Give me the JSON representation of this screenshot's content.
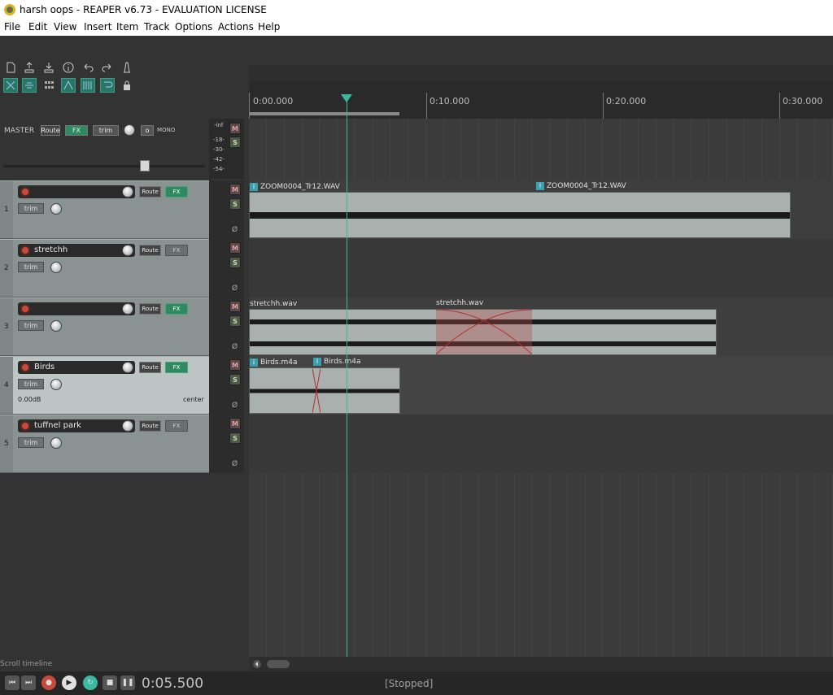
{
  "window": {
    "title": "harsh oops - REAPER v6.73 - EVALUATION LICENSE"
  },
  "menu": [
    "File",
    "Edit",
    "View",
    "Insert",
    "Item",
    "Track",
    "Options",
    "Actions",
    "Help"
  ],
  "toolbar": {
    "row1_icons": [
      "new-project-icon",
      "save-icon",
      "load-icon",
      "info-icon",
      "undo-icon",
      "redo-icon",
      "metronome-icon"
    ],
    "row2_icons": [
      "ripple-icon",
      "link-icon",
      "grid-icon",
      "auto-crossfade-icon",
      "snap-icon",
      "loop-icon",
      "lock-icon"
    ]
  },
  "ruler": {
    "labels": [
      "0:00.000",
      "0:10.000",
      "0:20.000",
      "0:30.000"
    ]
  },
  "master": {
    "label": "MASTER",
    "route": "Route",
    "fx": "FX",
    "trim": "trim",
    "mono": "MONO",
    "meter_labels": [
      "-inf",
      "-18-",
      "-30-",
      "-42-",
      "-54-"
    ],
    "mute": "M",
    "solo": "S"
  },
  "tracks": [
    {
      "num": "1",
      "name": "",
      "route": "Route",
      "fx": "FX",
      "trim": "trim",
      "fx_on": true,
      "vol": "",
      "pan": ""
    },
    {
      "num": "2",
      "name": "stretchh",
      "route": "Route",
      "fx": "FX",
      "trim": "trim",
      "fx_on": false,
      "vol": "",
      "pan": ""
    },
    {
      "num": "3",
      "name": "",
      "route": "Route",
      "fx": "FX",
      "trim": "trim",
      "fx_on": true,
      "vol": "",
      "pan": ""
    },
    {
      "num": "4",
      "name": "Birds",
      "route": "Route",
      "fx": "FX",
      "trim": "trim",
      "fx_on": true,
      "vol": "0.00dB",
      "pan": "center"
    },
    {
      "num": "5",
      "name": "tuffnel park",
      "route": "Route",
      "fx": "FX",
      "trim": "trim",
      "fx_on": false,
      "vol": "",
      "pan": ""
    }
  ],
  "ms": {
    "mute": "M",
    "solo": "S",
    "phase": "Ø"
  },
  "items": {
    "t1a": "ZOOM0004_Tr12.WAV",
    "t1b": "ZOOM0004_Tr12.WAV",
    "t3a": "stretchh.wav",
    "t3b": "stretchh.wav",
    "t4a": "Birds.m4a",
    "t4b": "Birds.m4a"
  },
  "footer": {
    "scroll_label": "Scroll timeline",
    "timecode": "0:05.500",
    "status": "[Stopped]"
  },
  "colors": {
    "accent": "#3ab8a0",
    "fx_on": "#2f8a62",
    "mute": "#c84a3a"
  }
}
